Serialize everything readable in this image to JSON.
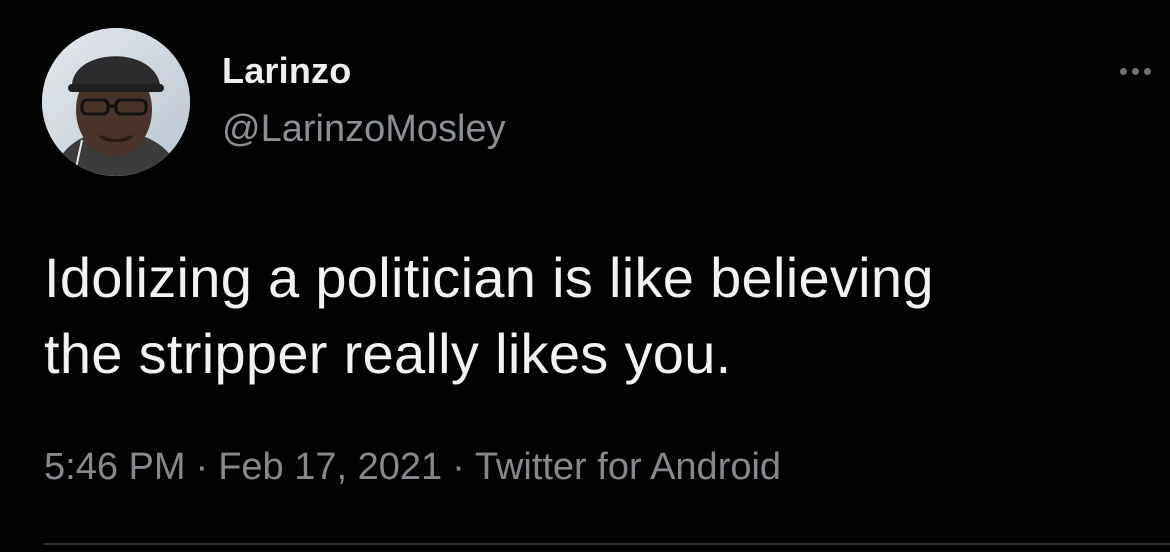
{
  "tweet": {
    "author": {
      "display_name": "Larinzo",
      "handle": "@LarinzoMosley"
    },
    "text_lines": [
      "Idolizing a politician is like believing",
      "the stripper really likes you."
    ],
    "meta": {
      "time": "5:46 PM",
      "date": "Feb 17, 2021",
      "source": "Twitter for Android",
      "separator": "·"
    },
    "icons": {
      "more": "more-options-icon",
      "avatar": "avatar"
    },
    "colors": {
      "background": "#020202",
      "text": "#f2f2f2",
      "secondary": "#85898e"
    }
  }
}
